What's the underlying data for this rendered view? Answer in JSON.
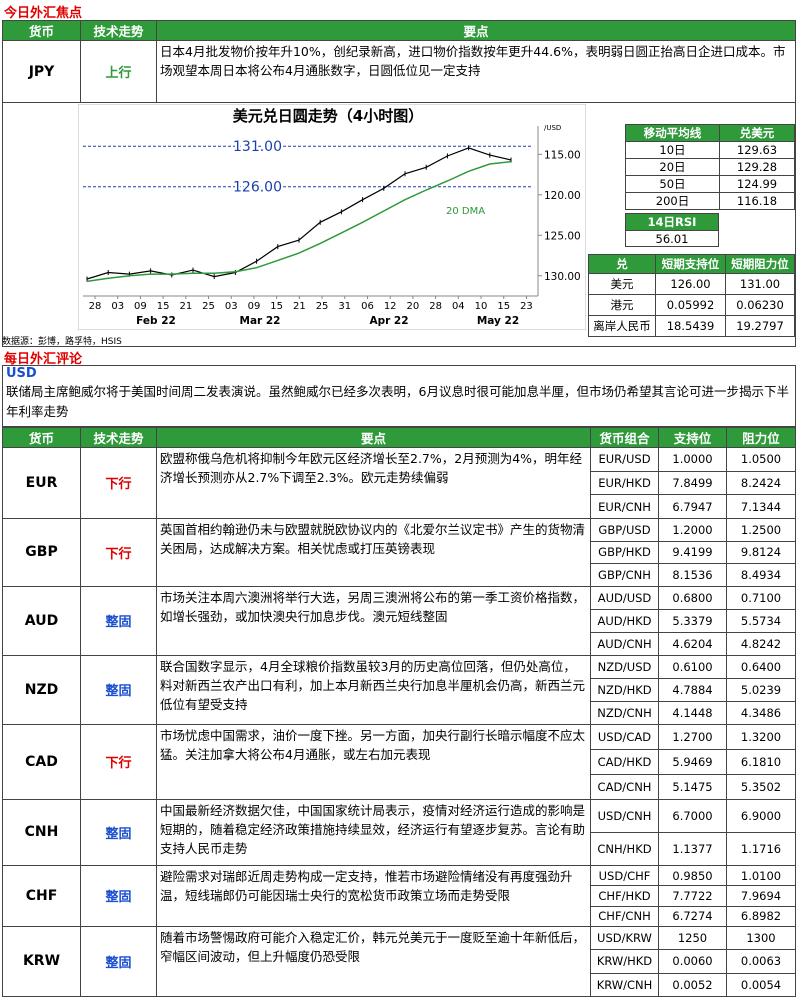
{
  "focus": {
    "title": "今日外汇焦点",
    "headers": [
      "货币",
      "技术走势",
      "要点"
    ],
    "currency": "JPY",
    "trend": "上行",
    "point": "日本4月批发物价按年升10%，创纪录新高，进口物价指数按年更升44.6%，表明弱日圆正抬高日企进口成本。市场观望本周日本将公布4月通胀数字，日圆低位见一定支持"
  },
  "chart": {
    "title": "美元兑日圆走势（4小时图）",
    "unit": "/USD",
    "source": "数据源：彭博，路孚特，HSIS",
    "dma_label": "20 DMA",
    "ref_lines": [
      "131.00",
      "126.00"
    ],
    "x_ticks": [
      "28",
      "03",
      "09",
      "15",
      "21",
      "25",
      "03",
      "09",
      "15",
      "21",
      "25",
      "31",
      "06",
      "12",
      "20",
      "28",
      "04",
      "10",
      "15",
      "23"
    ],
    "month_labels": [
      "Feb 22",
      "Mar 22",
      "Apr 22",
      "May 22"
    ],
    "y_ticks": [
      "130.00",
      "125.00",
      "120.00",
      "115.00"
    ]
  },
  "chart_data": {
    "type": "line",
    "title": "美元兑日圆走势（4小时图）",
    "ylim": [
      112.5,
      133.5
    ],
    "y_ticks": [
      115,
      120,
      125,
      130
    ],
    "x": [
      "Feb 22",
      "",
      "",
      "",
      "",
      "Mar 22",
      "",
      "",
      "",
      "",
      "",
      "",
      "Apr 22",
      "",
      "",
      "",
      "",
      "",
      "May 22",
      "",
      ""
    ],
    "series": [
      {
        "name": "USD/JPY",
        "values": [
          114.6,
          115.4,
          115.2,
          115.6,
          115.1,
          115.7,
          114.9,
          115.4,
          116.8,
          118.6,
          119.4,
          121.6,
          122.9,
          124.4,
          125.8,
          127.6,
          128.4,
          129.8,
          130.8,
          129.9,
          129.3
        ]
      },
      {
        "name": "20 DMA",
        "values": [
          114.3,
          114.7,
          115.0,
          115.2,
          115.2,
          115.3,
          115.3,
          115.5,
          116.0,
          116.9,
          117.8,
          119.0,
          120.3,
          121.6,
          123.0,
          124.4,
          125.6,
          126.7,
          127.9,
          128.8,
          129.1
        ]
      }
    ],
    "ref_lines": [
      131,
      126
    ]
  },
  "ma": {
    "headers": [
      "移动平均线",
      "兑美元"
    ],
    "rows": [
      [
        "10日",
        "129.63"
      ],
      [
        "20日",
        "129.28"
      ],
      [
        "50日",
        "124.99"
      ],
      [
        "200日",
        "116.18"
      ]
    ],
    "rsi_label": "14日RSI",
    "rsi": "56.01"
  },
  "sr": {
    "headers": [
      "兑",
      "短期支持位",
      "短期阻力位"
    ],
    "rows": [
      [
        "美元",
        "126.00",
        "131.00"
      ],
      [
        "港元",
        "0.05992",
        "0.06230"
      ],
      [
        "离岸人民币",
        "18.5439",
        "19.2797"
      ]
    ]
  },
  "review": {
    "title": "每日外汇评论",
    "usd_label": "USD",
    "usd_text": "联储局主席鲍威尔将于美国时间周二发表演说。虽然鲍威尔已经多次表明，6月议息时很可能加息半厘，但市场仍希望其言论可进一步揭示下半年利率走势",
    "headers": [
      "货币",
      "技术走势",
      "要点",
      "货币组合",
      "支持位",
      "阻力位"
    ],
    "rows": [
      {
        "cur": "EUR",
        "trend": "下行",
        "tc": "down",
        "text": "欧盟称俄乌危机将抑制今年欧元区经济增长至2.7%，2月预测为4%，明年经济增长预测亦从2.7%下调至2.3%。欧元走势续偏弱",
        "pairs": [
          [
            "EUR/USD",
            "1.0000",
            "1.0500"
          ],
          [
            "EUR/HKD",
            "7.8499",
            "8.2424"
          ],
          [
            "EUR/CNH",
            "6.7947",
            "7.1344"
          ]
        ]
      },
      {
        "cur": "GBP",
        "trend": "下行",
        "tc": "down",
        "text": "英国首相约翰逊仍未与欧盟就脱欧协议内的《北爱尔兰议定书》产生的货物清关困局，达成解决方案。相关忧虑或打压英镑表现",
        "pairs": [
          [
            "GBP/USD",
            "1.2000",
            "1.2500"
          ],
          [
            "GBP/HKD",
            "9.4199",
            "9.8124"
          ],
          [
            "GBP/CNH",
            "8.1536",
            "8.4934"
          ]
        ]
      },
      {
        "cur": "AUD",
        "trend": "整固",
        "tc": "flat",
        "text": "市场关注本周六澳洲将举行大选，另周三澳洲将公布的第一季工资价格指数，如增长强劲，或加快澳央行加息步伐。澳元短线整固",
        "pairs": [
          [
            "AUD/USD",
            "0.6800",
            "0.7100"
          ],
          [
            "AUD/HKD",
            "5.3379",
            "5.5734"
          ],
          [
            "AUD/CNH",
            "4.6204",
            "4.8242"
          ]
        ]
      },
      {
        "cur": "NZD",
        "trend": "整固",
        "tc": "flat",
        "text": "联合国数字显示，4月全球粮价指数虽较3月的历史高位回落，但仍处高位，料对新西兰农产出口有利，加上本月新西兰央行加息半厘机会仍高，新西兰元低位有望受支持",
        "pairs": [
          [
            "NZD/USD",
            "0.6100",
            "0.6400"
          ],
          [
            "NZD/HKD",
            "4.7884",
            "5.0239"
          ],
          [
            "NZD/CNH",
            "4.1448",
            "4.3486"
          ]
        ]
      },
      {
        "cur": "CAD",
        "trend": "下行",
        "tc": "down",
        "text": "市场忧虑中国需求，油价一度下挫。另一方面，加央行副行长暗示幅度不应太猛。关注加拿大将公布4月通胀，或左右加元表现",
        "pairs": [
          [
            "USD/CAD",
            "1.2700",
            "1.3200"
          ],
          [
            "CAD/HKD",
            "5.9469",
            "6.1810"
          ],
          [
            "CAD/CNH",
            "5.1475",
            "5.3502"
          ]
        ]
      },
      {
        "cur": "CNH",
        "trend": "整固",
        "tc": "flat",
        "text": "中国最新经济数据欠佳，中国国家统计局表示，疫情对经济运行造成的影响是短期的，随着稳定经济政策措施持续显效，经济运行有望逐步复苏。言论有助支持人民币走势",
        "pairs": [
          [
            "USD/CNH",
            "6.7000",
            "6.9000"
          ],
          [
            "CNH/HKD",
            "1.1377",
            "1.1716"
          ]
        ]
      },
      {
        "cur": "CHF",
        "trend": "整固",
        "tc": "flat",
        "text": "避险需求对瑞郎近周走势构成一定支持，惟若市场避险情绪没有再度强劲升温，短线瑞郎仍可能因瑞士央行的宽松货币政策立场而走势受限",
        "pairs": [
          [
            "USD/CHF",
            "0.9850",
            "1.0100"
          ],
          [
            "CHF/HKD",
            "7.7722",
            "7.9694"
          ],
          [
            "CHF/CNH",
            "6.7274",
            "6.8982"
          ]
        ]
      },
      {
        "cur": "KRW",
        "trend": "整固",
        "tc": "flat",
        "text": "随着市场警惕政府可能介入稳定汇价，韩元兑美元于一度贬至逾十年新低后，窄幅区间波动，但上升幅度仍恐受限",
        "pairs": [
          [
            "USD/KRW",
            "1250",
            "1300"
          ],
          [
            "KRW/HKD",
            "0.0060",
            "0.0063"
          ],
          [
            "KRW/CNH",
            "0.0052",
            "0.0054"
          ]
        ]
      }
    ]
  }
}
